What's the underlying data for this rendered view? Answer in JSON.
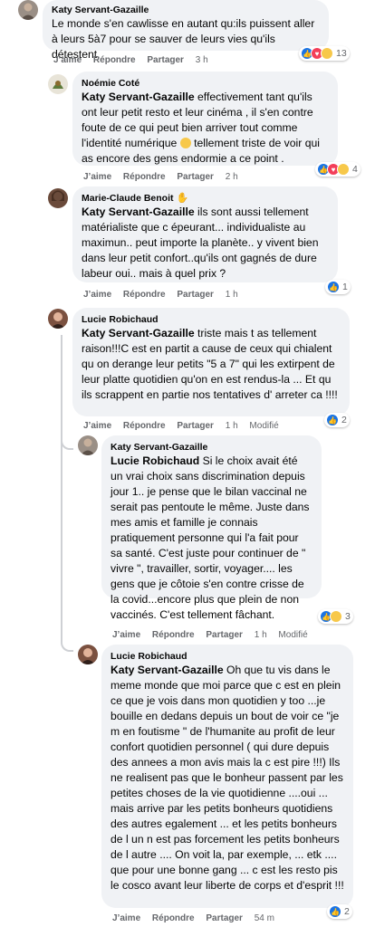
{
  "actions": {
    "like": "J’aime",
    "reply": "Répondre",
    "share": "Partager"
  },
  "comments": [
    {
      "author": "Katy Servant-Gazaille",
      "text": "Le monde s'en cawlisse en autant qu:ils puissent aller à leurs 5à7 pour se sauver de leurs vies qu'ils détestent.",
      "time": "3 h",
      "reaction_count": "13",
      "reactions": [
        "like",
        "love",
        "sad"
      ]
    },
    {
      "author": "Noémie Coté",
      "mention": "Katy Servant-Gazaille",
      "text_before": " effectivement tant qu'ils ont leur petit resto et leur cinéma , il s'en contre foute de ce qui peut bien arriver tout comme l'identité numérique ",
      "text_after": " tellement triste de voir qui as encore des gens endormie a ce point .",
      "emoji": "sad-face-emoji",
      "time": "2 h",
      "reaction_count": "4",
      "reactions": [
        "like",
        "love",
        "haha"
      ]
    },
    {
      "author": "Marie-Claude Benoit",
      "author_badge": "raised-hand-icon",
      "mention": "Katy Servant-Gazaille",
      "text": " ils sont aussi tellement matérialiste que c épeurant... individualiste au maximun.. peut importe la planète.. y vivent bien dans leur petit confort..qu'ils ont gagnés de dure labeur oui.. mais à quel prix ?",
      "time": "1 h",
      "reaction_count": "1",
      "reactions": [
        "like"
      ]
    },
    {
      "author": "Lucie Robichaud",
      "mention": "Katy Servant-Gazaille",
      "text": " triste mais t as tellement raison!!!C est en partit a cause de ceux qui chialent qu on derange leur petits \"5 a 7\" qui les extirpent de leur platte quotidien qu'on en est rendus-la ... Et qu ils scrappent en partie nos tentatives d' arreter ca !!!!",
      "time": "1 h",
      "edited": "Modifié",
      "reaction_count": "2",
      "reactions": [
        "like"
      ]
    },
    {
      "author": "Katy Servant-Gazaille",
      "mention": "Lucie Robichaud",
      "text": " Si le choix avait été un vrai choix sans discrimination depuis jour 1.. je pense que le bilan vaccinal ne serait pas pentoute le même. Juste dans mes amis et famille je connais pratiquement personne qui l'a fait pour sa santé. C'est juste pour continuer de \" vivre \", travailler, sortir, voyager.... les gens que je côtoie s'en contre crisse de la covid...encore plus que plein de non vaccinés. C'est tellement fâchant.",
      "time": "1 h",
      "edited": "Modifié",
      "reaction_count": "3",
      "reactions": [
        "like",
        "haha"
      ]
    },
    {
      "author": "Lucie Robichaud",
      "mention": "Katy Servant-Gazaille",
      "text": " Oh que tu vis dans le meme monde que moi parce que c est en plein ce que je vois dans mon quotidien y too ...je bouille en dedans depuis un bout de voir ce \"je m en foutisme \" de l'humanite au profit de leur confort quotidien personnel ( qui dure depuis des annees a mon avis mais la c est pire !!!) Ils ne realisent pas que le bonheur passent par les petites choses de la vie quotidienne ....oui ... mais arrive par les petits bonheurs quotidiens des autres egalement ... et les petits bonheurs de l un n est pas forcement les petits bonheurs de l autre .... On voit la, par exemple, ... etk .... que pour une bonne gang ... c est les resto pis le cosco avant leur liberte de corps et d'esprit !!!",
      "time": "54 m",
      "reaction_count": "2",
      "reactions": [
        "like"
      ]
    }
  ]
}
